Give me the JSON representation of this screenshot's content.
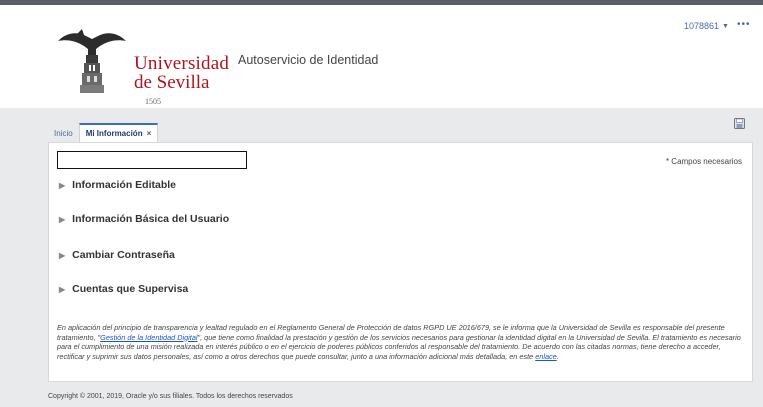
{
  "header": {
    "logo": {
      "line1": "Universidad",
      "line2": "de Sevilla",
      "year": "1505"
    },
    "app_title": "Autoservicio de Identidad",
    "user_id": "1078861",
    "more": "•••"
  },
  "tabs": [
    {
      "label": "Inicio",
      "active": false
    },
    {
      "label": "Mi Información",
      "active": true,
      "close": "×"
    }
  ],
  "content": {
    "required_note": "* Campos necesarios",
    "sections": [
      {
        "label": "Información Editable"
      },
      {
        "label": "Información Básica del Usuario"
      },
      {
        "label": "Cambiar Contraseña"
      },
      {
        "label": "Cuentas que Supervisa"
      }
    ],
    "legal": {
      "part1": "En aplicación del principio de transparencia y lealtad regulado en el Reglamento General de Protección de datos RGPD UE 2016/679, se le informa que la Universidad de Sevilla es responsable del presente tratamiento, \"",
      "link1": "Gestión de la Identidad Digital",
      "part2": "\", que tiene como finalidad la prestación y gestión de los servicios necesarios para gestionar la identidad digital en la Universidad de Sevilla. El tratamiento es necesario para el cumplimiento de una misión realizada en interés público o en el ejercicio de poderes públicos conferidos al responsable del tratamiento. De acuerdo con las citadas normas, tiene derecho a acceder, rectificar y suprimir sus datos personales, así como a otros derechos que puede consultar, junto a una información adicional más detallada, en este ",
      "link2": "enlace",
      "part3": "."
    }
  },
  "footer": {
    "copyright": "Copyright © 2001, 2019, Oracle y/o sus filiales. Todos los derechos reservados"
  },
  "colors": {
    "accent": "#3d6db5",
    "brand": "#b5121b",
    "link": "#1a56c4"
  }
}
